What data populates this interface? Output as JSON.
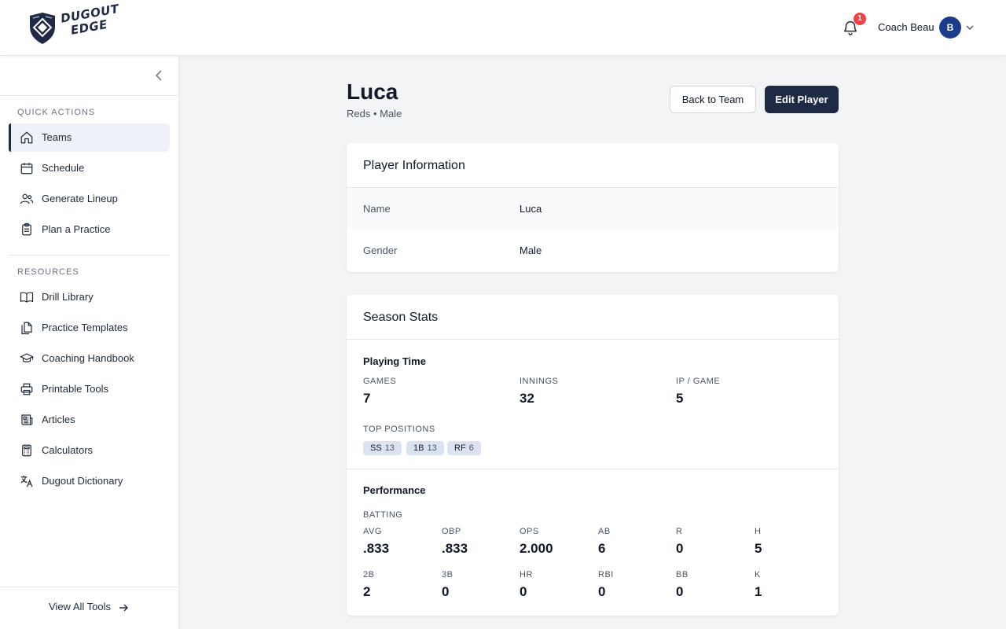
{
  "header": {
    "logo_line1": "DUGOUT",
    "logo_line2": "EDGE",
    "notifications_count": "1",
    "user_name": "Coach Beau",
    "avatar_initial": "B"
  },
  "sidebar": {
    "quick_actions_label": "QUICK ACTIONS",
    "quick_actions": [
      {
        "label": "Teams",
        "icon": "home-icon",
        "active": true
      },
      {
        "label": "Schedule",
        "icon": "calendar-icon"
      },
      {
        "label": "Generate Lineup",
        "icon": "users-icon"
      },
      {
        "label": "Plan a Practice",
        "icon": "clipboard-icon"
      }
    ],
    "resources_label": "RESOURCES",
    "resources": [
      {
        "label": "Drill Library",
        "icon": "book-open-icon"
      },
      {
        "label": "Practice Templates",
        "icon": "documents-icon"
      },
      {
        "label": "Coaching Handbook",
        "icon": "graduation-cap-icon"
      },
      {
        "label": "Printable Tools",
        "icon": "printer-icon"
      },
      {
        "label": "Articles",
        "icon": "newspaper-icon"
      },
      {
        "label": "Calculators",
        "icon": "calculator-icon"
      },
      {
        "label": "Dugout Dictionary",
        "icon": "translate-icon"
      }
    ],
    "view_all": "View All Tools"
  },
  "player": {
    "name": "Luca",
    "subtitle": "Reds • Male",
    "back_button": "Back to Team",
    "edit_button": "Edit Player"
  },
  "info_card": {
    "title": "Player Information",
    "rows": [
      {
        "label": "Name",
        "value": "Luca"
      },
      {
        "label": "Gender",
        "value": "Male"
      }
    ]
  },
  "stats_card": {
    "title": "Season Stats",
    "playing_time": {
      "title": "Playing Time",
      "stats": [
        {
          "label": "GAMES",
          "value": "7"
        },
        {
          "label": "INNINGS",
          "value": "32"
        },
        {
          "label": "IP / GAME",
          "value": "5"
        }
      ],
      "top_positions_label": "TOP POSITIONS",
      "top_positions": [
        {
          "pos": "SS",
          "count": "13"
        },
        {
          "pos": "1B",
          "count": "13"
        },
        {
          "pos": "RF",
          "count": "6"
        }
      ]
    },
    "performance": {
      "title": "Performance",
      "batting_label": "BATTING",
      "row1": [
        {
          "label": "AVG",
          "value": ".833"
        },
        {
          "label": "OBP",
          "value": ".833"
        },
        {
          "label": "OPS",
          "value": "2.000"
        },
        {
          "label": "AB",
          "value": "6"
        },
        {
          "label": "R",
          "value": "0"
        },
        {
          "label": "H",
          "value": "5"
        }
      ],
      "row2": [
        {
          "label": "2B",
          "value": "2"
        },
        {
          "label": "3B",
          "value": "0"
        },
        {
          "label": "HR",
          "value": "0"
        },
        {
          "label": "RBI",
          "value": "0"
        },
        {
          "label": "BB",
          "value": "0"
        },
        {
          "label": "K",
          "value": "1"
        }
      ]
    }
  }
}
